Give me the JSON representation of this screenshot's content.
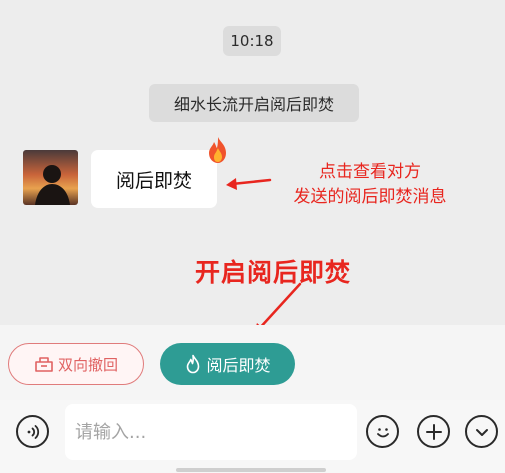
{
  "chat": {
    "time": "10:18",
    "system_notice": "细水长流开启阅后即焚",
    "message": {
      "text": "阅后即焚",
      "badge_icon": "fire-icon"
    }
  },
  "annotations": {
    "note_line1": "点击查看对方",
    "note_line2": "发送的阅后即焚消息",
    "heading": "开启阅后即焚",
    "color": "#e8261f"
  },
  "options": {
    "revoke_label": "双向撤回",
    "burn_label": "阅后即焚",
    "burn_color": "#2e9c94",
    "revoke_color": "#e06262"
  },
  "input_bar": {
    "placeholder": "请输入...",
    "icons": [
      "voice-icon",
      "emoji-icon",
      "plus-icon",
      "chevron-down-icon"
    ]
  }
}
